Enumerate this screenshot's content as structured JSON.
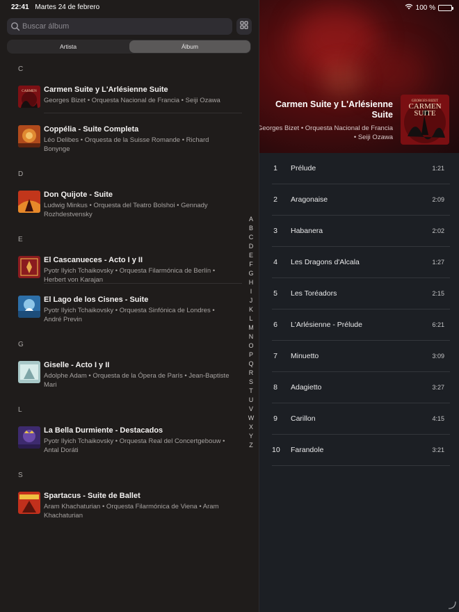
{
  "status_bar": {
    "time": "22:41",
    "date": "Martes 24 de febrero",
    "battery": "100 %",
    "battery_level": 1.0
  },
  "search": {
    "placeholder": "Buscar álbum"
  },
  "segments": [
    {
      "label": "Artista",
      "selected": false
    },
    {
      "label": "Álbum",
      "selected": true
    }
  ],
  "sections": [
    {
      "letter": "C",
      "albums": [
        {
          "title": "Carmen Suite y L'Arlésienne Suite",
          "subtitle": "Georges Bizet • Orquesta Nacional de Francia • Seiji Ozawa",
          "art": "carmen"
        },
        {
          "title": "Coppélia - Suite Completa",
          "subtitle": "Léo Delibes • Orquesta de la Suisse Romande • Richard Bonynge",
          "art": "coppelia"
        }
      ]
    },
    {
      "letter": "D",
      "albums": [
        {
          "title": "Don Quijote - Suite",
          "subtitle": "Ludwig Minkus • Orquesta del Teatro Bolshoi • Gennady Rozhdestvensky",
          "art": "quijote"
        }
      ]
    },
    {
      "letter": "E",
      "albums": [
        {
          "title": "El Cascanueces - Acto I y II",
          "subtitle": "Pyotr Ilyich Tchaikovsky • Orquesta Filarmónica de Berlín • Herbert von Karajan",
          "art": "cascanueces"
        },
        {
          "title": "El Lago de los Cisnes - Suite",
          "subtitle": "Pyotr Ilyich Tchaikovsky • Orquesta Sinfónica de Londres • André Previn",
          "art": "lago"
        }
      ]
    },
    {
      "letter": "G",
      "albums": [
        {
          "title": "Giselle - Acto I y II",
          "subtitle": "Adolphe Adam • Orquesta de la Ópera de París • Jean-Baptiste Mari",
          "art": "giselle"
        }
      ]
    },
    {
      "letter": "L",
      "albums": [
        {
          "title": "La Bella Durmiente - Destacados",
          "subtitle": "Pyotr Ilyich Tchaikovsky • Orquesta Real del Concertgebouw • Antal Doráti",
          "art": "bella"
        }
      ]
    },
    {
      "letter": "S",
      "albums": [
        {
          "title": "Spartacus - Suite de Ballet",
          "subtitle": "Aram Khachaturian • Orquesta Filarmónica de Viena • Aram Khachaturian",
          "art": "spartacus"
        }
      ]
    }
  ],
  "index_letters": [
    "A",
    "B",
    "C",
    "D",
    "E",
    "F",
    "G",
    "H",
    "I",
    "J",
    "K",
    "L",
    "M",
    "N",
    "O",
    "P",
    "Q",
    "R",
    "S",
    "T",
    "U",
    "V",
    "W",
    "X",
    "Y",
    "Z"
  ],
  "detail": {
    "title": "Carmen Suite y L'Arlésienne Suite",
    "subtitle": "Georges Bizet • Orquesta Nacional de Francia • Seiji Ozawa",
    "art_top_text": "GEORGES BIZET",
    "art_main_text": "CARMEN SUITE",
    "tracks": [
      {
        "number": "1",
        "name": "Prélude",
        "duration": "1:21"
      },
      {
        "number": "2",
        "name": "Aragonaise",
        "duration": "2:09"
      },
      {
        "number": "3",
        "name": "Habanera",
        "duration": "2:02"
      },
      {
        "number": "4",
        "name": "Les Dragons d'Alcala",
        "duration": "1:27"
      },
      {
        "number": "5",
        "name": "Les Toréadors",
        "duration": "2:15"
      },
      {
        "number": "6",
        "name": "L'Arlésienne - Prélude",
        "duration": "6:21"
      },
      {
        "number": "7",
        "name": "Minuetto",
        "duration": "3:09"
      },
      {
        "number": "8",
        "name": "Adagietto",
        "duration": "3:27"
      },
      {
        "number": "9",
        "name": "Carillon",
        "duration": "4:15"
      },
      {
        "number": "10",
        "name": "Farandole",
        "duration": "3:21"
      }
    ]
  },
  "colors": {
    "accent": "#5a5858",
    "background": "#1f1c1b",
    "detail_background": "#1c1f24",
    "header_red": "#7a1414"
  }
}
